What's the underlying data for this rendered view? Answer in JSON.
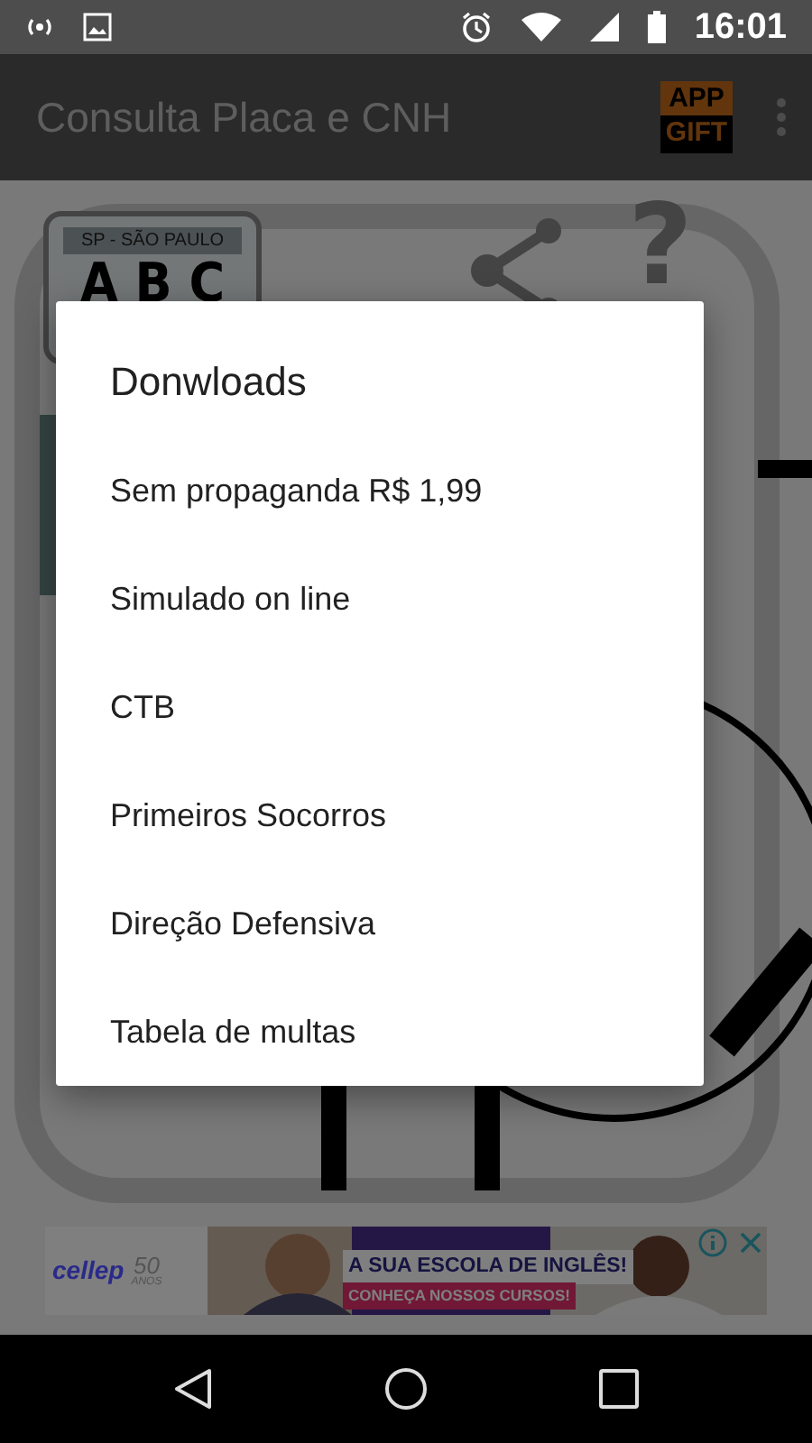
{
  "status_bar": {
    "time": "16:01"
  },
  "toolbar": {
    "title": "Consulta Placa e CNH",
    "gift_badge": [
      "APP",
      "GIFT"
    ]
  },
  "background": {
    "plate_state": "SP - SÃO PAULO",
    "plate_letters": "A B C",
    "help_mark": "?"
  },
  "dialog": {
    "title": "Donwloads",
    "items": [
      {
        "label": "Sem propaganda R$ 1,99"
      },
      {
        "label": "Simulado on line"
      },
      {
        "label": "CTB"
      },
      {
        "label": "Primeiros Socorros"
      },
      {
        "label": "Direção Defensiva"
      },
      {
        "label": "Tabela de multas"
      }
    ]
  },
  "ad": {
    "brand": "cellep",
    "years": "50",
    "years_label": "ANOS",
    "headline": "A SUA ESCOLA DE INGLÊS!",
    "cta": "CONHEÇA NOSSOS CURSOS!"
  }
}
